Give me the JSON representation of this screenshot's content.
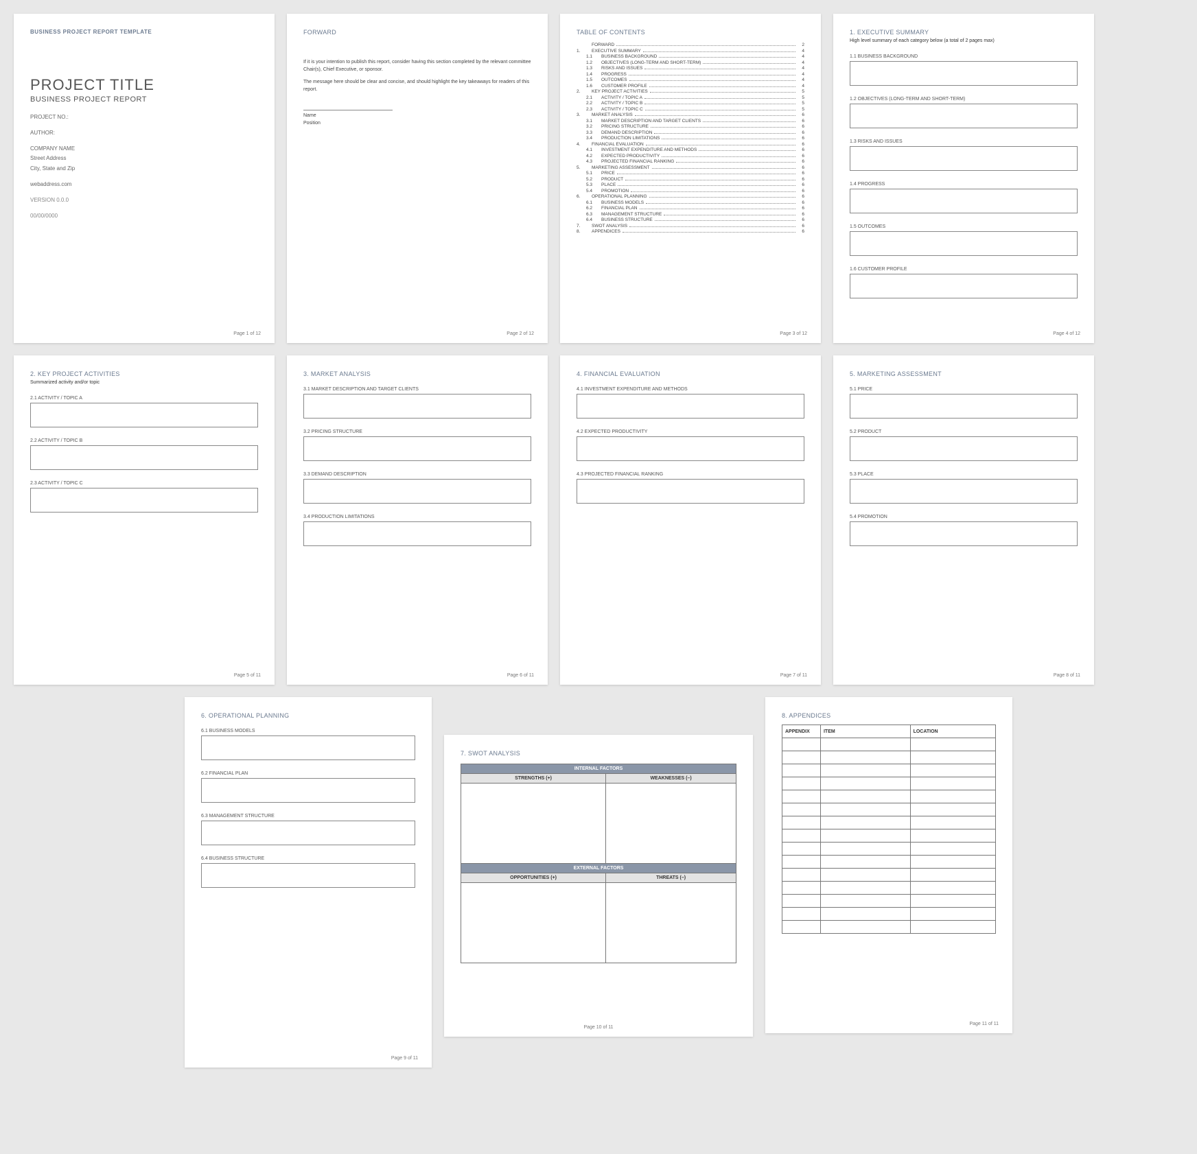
{
  "page1": {
    "header": "BUSINESS PROJECT REPORT TEMPLATE",
    "title": "PROJECT TITLE",
    "subtitle": "BUSINESS PROJECT REPORT",
    "project_no": "PROJECT NO.:",
    "author": "AUTHOR:",
    "company": "COMPANY NAME",
    "street": "Street Address",
    "city": "City, State and Zip",
    "web": "webaddress.com",
    "version": "VERSION 0.0.0",
    "date": "00/00/0000",
    "footer": "Page 1 of 12"
  },
  "page2": {
    "heading": "FORWARD",
    "para1": "If it is your intention to publish this report, consider having this section completed by the relevant committee Chair(s), Chief Executive, or sponsor.",
    "para2": "The message here should be clear and concise, and should highlight the key takeaways for readers of this report.",
    "name": "Name",
    "position": "Position",
    "footer": "Page 2 of 12"
  },
  "page3": {
    "heading": "TABLE OF CONTENTS",
    "items": [
      {
        "n": "",
        "t": "FORWARD",
        "p": "2"
      },
      {
        "n": "1.",
        "t": "EXECUTIVE SUMMARY",
        "p": "4"
      },
      {
        "n": "1.1",
        "t": "BUSINESS BACKGROUND",
        "p": "4"
      },
      {
        "n": "1.2",
        "t": "OBJECTIVES (LONG-TERM AND SHORT-TERM)",
        "p": "4"
      },
      {
        "n": "1.3",
        "t": "RISKS AND ISSUES",
        "p": "4"
      },
      {
        "n": "1.4",
        "t": "PROGRESS",
        "p": "4"
      },
      {
        "n": "1.5",
        "t": "OUTCOMES",
        "p": "4"
      },
      {
        "n": "1.6",
        "t": "CUSTOMER PROFILE",
        "p": "4"
      },
      {
        "n": "2.",
        "t": "KEY PROJECT ACTIVITIES",
        "p": "5"
      },
      {
        "n": "2.1",
        "t": "ACTIVITY / TOPIC A",
        "p": "5"
      },
      {
        "n": "2.2",
        "t": "ACTIVITY / TOPIC B",
        "p": "5"
      },
      {
        "n": "2.3",
        "t": "ACTIVITY / TOPIC C",
        "p": "5"
      },
      {
        "n": "3.",
        "t": "MARKET ANALYSIS",
        "p": "6"
      },
      {
        "n": "3.1",
        "t": "MARKET DESCRIPTION AND TARGET CLIENTS",
        "p": "6"
      },
      {
        "n": "3.2",
        "t": "PRICING STRUCTURE",
        "p": "6"
      },
      {
        "n": "3.3",
        "t": "DEMAND DESCRIPTION",
        "p": "6"
      },
      {
        "n": "3.4",
        "t": "PRODUCTION LIMITATIONS",
        "p": "6"
      },
      {
        "n": "4.",
        "t": "FINANCIAL EVALUATION",
        "p": "6"
      },
      {
        "n": "4.1",
        "t": "INVESTMENT EXPENDITURE AND METHODS",
        "p": "6"
      },
      {
        "n": "4.2",
        "t": "EXPECTED PRODUCTIVITY",
        "p": "6"
      },
      {
        "n": "4.3",
        "t": "PROJECTED FINANCIAL RANKING",
        "p": "6"
      },
      {
        "n": "5.",
        "t": "MARKETING ASSESSMENT",
        "p": "6"
      },
      {
        "n": "5.1",
        "t": "PRICE",
        "p": "6"
      },
      {
        "n": "5.2",
        "t": "PRODUCT",
        "p": "6"
      },
      {
        "n": "5.3",
        "t": "PLACE",
        "p": "6"
      },
      {
        "n": "5.4",
        "t": "PROMOTION",
        "p": "6"
      },
      {
        "n": "6.",
        "t": "OPERATIONAL PLANNING",
        "p": "6"
      },
      {
        "n": "6.1",
        "t": "BUSINESS MODELS",
        "p": "6"
      },
      {
        "n": "6.2",
        "t": "FINANCIAL PLAN",
        "p": "6"
      },
      {
        "n": "6.3",
        "t": "MANAGEMENT STRUCTURE",
        "p": "6"
      },
      {
        "n": "6.4",
        "t": "BUSINESS STRUCTURE",
        "p": "6"
      },
      {
        "n": "7.",
        "t": "SWOT ANALYSIS",
        "p": "6"
      },
      {
        "n": "8.",
        "t": "APPENDICES",
        "p": "6"
      }
    ],
    "footer": "Page 3 of 12"
  },
  "page4": {
    "heading": "1. EXECUTIVE SUMMARY",
    "desc": "High level summary of each category below (a total of 2 pages max)",
    "s1": "1.1  BUSINESS BACKGROUND",
    "s2": "1.2  OBJECTIVES (LONG-TERM AND SHORT-TERM)",
    "s3": "1.3  RISKS AND ISSUES",
    "s4": "1.4  PROGRESS",
    "s5": "1.5  OUTCOMES",
    "s6": "1.6  CUSTOMER PROFILE",
    "footer": "Page 4 of 12"
  },
  "page5": {
    "heading": "2. KEY PROJECT ACTIVITIES",
    "desc": "Summarized activity and/or topic",
    "s1": "2.1  ACTIVITY / TOPIC A",
    "s2": "2.2  ACTIVITY / TOPIC B",
    "s3": "2.3  ACTIVITY / TOPIC C",
    "footer": "Page 5 of 11"
  },
  "page6": {
    "heading": "3. MARKET ANALYSIS",
    "s1": "3.1  MARKET DESCRIPTION AND TARGET CLIENTS",
    "s2": "3.2  PRICING STRUCTURE",
    "s3": "3.3  DEMAND DESCRIPTION",
    "s4": "3.4  PRODUCTION LIMITATIONS",
    "footer": "Page 6 of 11"
  },
  "page7": {
    "heading": "4. FINANCIAL EVALUATION",
    "s1": "4.1  INVESTMENT EXPENDITURE AND METHODS",
    "s2": "4.2  EXPECTED PRODUCTIVITY",
    "s3": "4.3  PROJECTED FINANCIAL RANKING",
    "footer": "Page 7 of 11"
  },
  "page8": {
    "heading": "5. MARKETING ASSESSMENT",
    "s1": "5.1  PRICE",
    "s2": "5.2  PRODUCT",
    "s3": "5.3  PLACE",
    "s4": "5.4  PROMOTION",
    "footer": "Page 8 of 11"
  },
  "page9": {
    "heading": "6. OPERATIONAL PLANNING",
    "s1": "6.1  BUSINESS MODELS",
    "s2": "6.2  FINANCIAL PLAN",
    "s3": "6.3  MANAGEMENT STRUCTURE",
    "s4": "6.4  BUSINESS STRUCTURE",
    "footer": "Page 9 of 11"
  },
  "page10": {
    "heading": "7. SWOT ANALYSIS",
    "internal": "INTERNAL FACTORS",
    "strengths": "STRENGTHS (+)",
    "weaknesses": "WEAKNESSES (–)",
    "external": "EXTERNAL FACTORS",
    "opportunities": "OPPORTUNITIES (+)",
    "threats": "THREATS (–)",
    "footer": "Page 10 of 11"
  },
  "page11": {
    "heading": "8. APPENDICES",
    "col1": "APPENDIX",
    "col2": "ITEM",
    "col3": "LOCATION",
    "footer": "Page 11 of 11"
  }
}
